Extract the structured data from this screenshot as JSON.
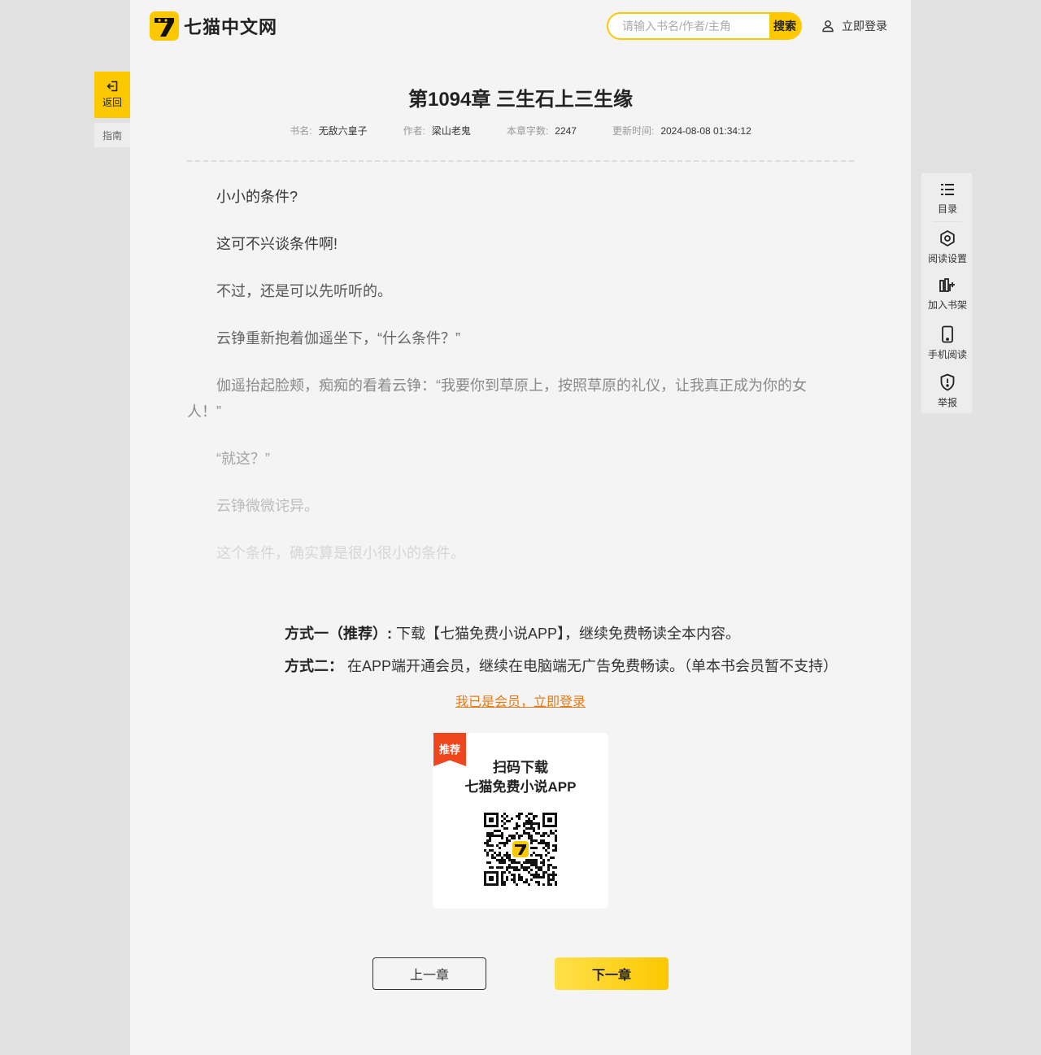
{
  "header": {
    "logo_text": "七猫中文网",
    "search_placeholder": "请输入书名/作者/主角",
    "search_button": "搜索",
    "login_label": "立即登录"
  },
  "left_nav": {
    "back_label": "返回",
    "guide_label": "指南"
  },
  "chapter": {
    "title": "第1094章 三生石上三生缘",
    "meta": [
      {
        "label": "书名:",
        "value": "无敌六皇子"
      },
      {
        "label": "作者:",
        "value": "梁山老鬼"
      },
      {
        "label": "本章字数:",
        "value": "2247"
      },
      {
        "label": "更新时间:",
        "value": "2024-08-08 01:34:12"
      }
    ],
    "paragraphs": [
      {
        "text": "小小的条件?",
        "color": "#333333"
      },
      {
        "text": "这可不兴谈条件啊!",
        "color": "#3a3a3a"
      },
      {
        "text": "不过，还是可以先听听的。",
        "color": "#555555"
      },
      {
        "text": "云铮重新抱着伽遥坐下，“什么条件？”",
        "color": "#666666"
      },
      {
        "text": "伽遥抬起脸颊，痴痴的看着云铮：“我要你到草原上，按照草原的礼仪，让我真正成为你的女人！”",
        "color": "#8a8a8a"
      },
      {
        "text": "“就这？”",
        "color": "#a3a3a3"
      },
      {
        "text": "云铮微微诧异。",
        "color": "#bdbdbd"
      },
      {
        "text": "这个条件，确实算是很小很小的条件。",
        "color": "#d6d6d6"
      }
    ]
  },
  "unlock": {
    "way1_label": "方式一（推荐）:",
    "way1_text": "下载【七猫免费小说APP】，继续免费畅读全本内容。",
    "way2_label": "方式二：",
    "way2_text": "在APP端开通会员，继续在电脑端无广告免费畅读。（单本书会员暂不支持）",
    "member_link": "我已是会员，立即登录"
  },
  "qr": {
    "tag": "推荐",
    "title_line1": "扫码下载",
    "title_line2": "七猫免费小说APP"
  },
  "nav": {
    "prev": "上一章",
    "next": "下一章"
  },
  "toolbar": [
    {
      "label": "目录",
      "icon": "list-icon"
    },
    {
      "label": "阅读设置",
      "icon": "gear-icon"
    },
    {
      "label": "加入书架",
      "icon": "bookshelf-add-icon"
    },
    {
      "label": "手机阅读",
      "icon": "phone-icon"
    },
    {
      "label": "举报",
      "icon": "shield-alert-icon"
    }
  ],
  "colors": {
    "brand_yellow": "#fcc800",
    "link_orange": "#e07b1a",
    "tag_red": "#f0461e"
  }
}
